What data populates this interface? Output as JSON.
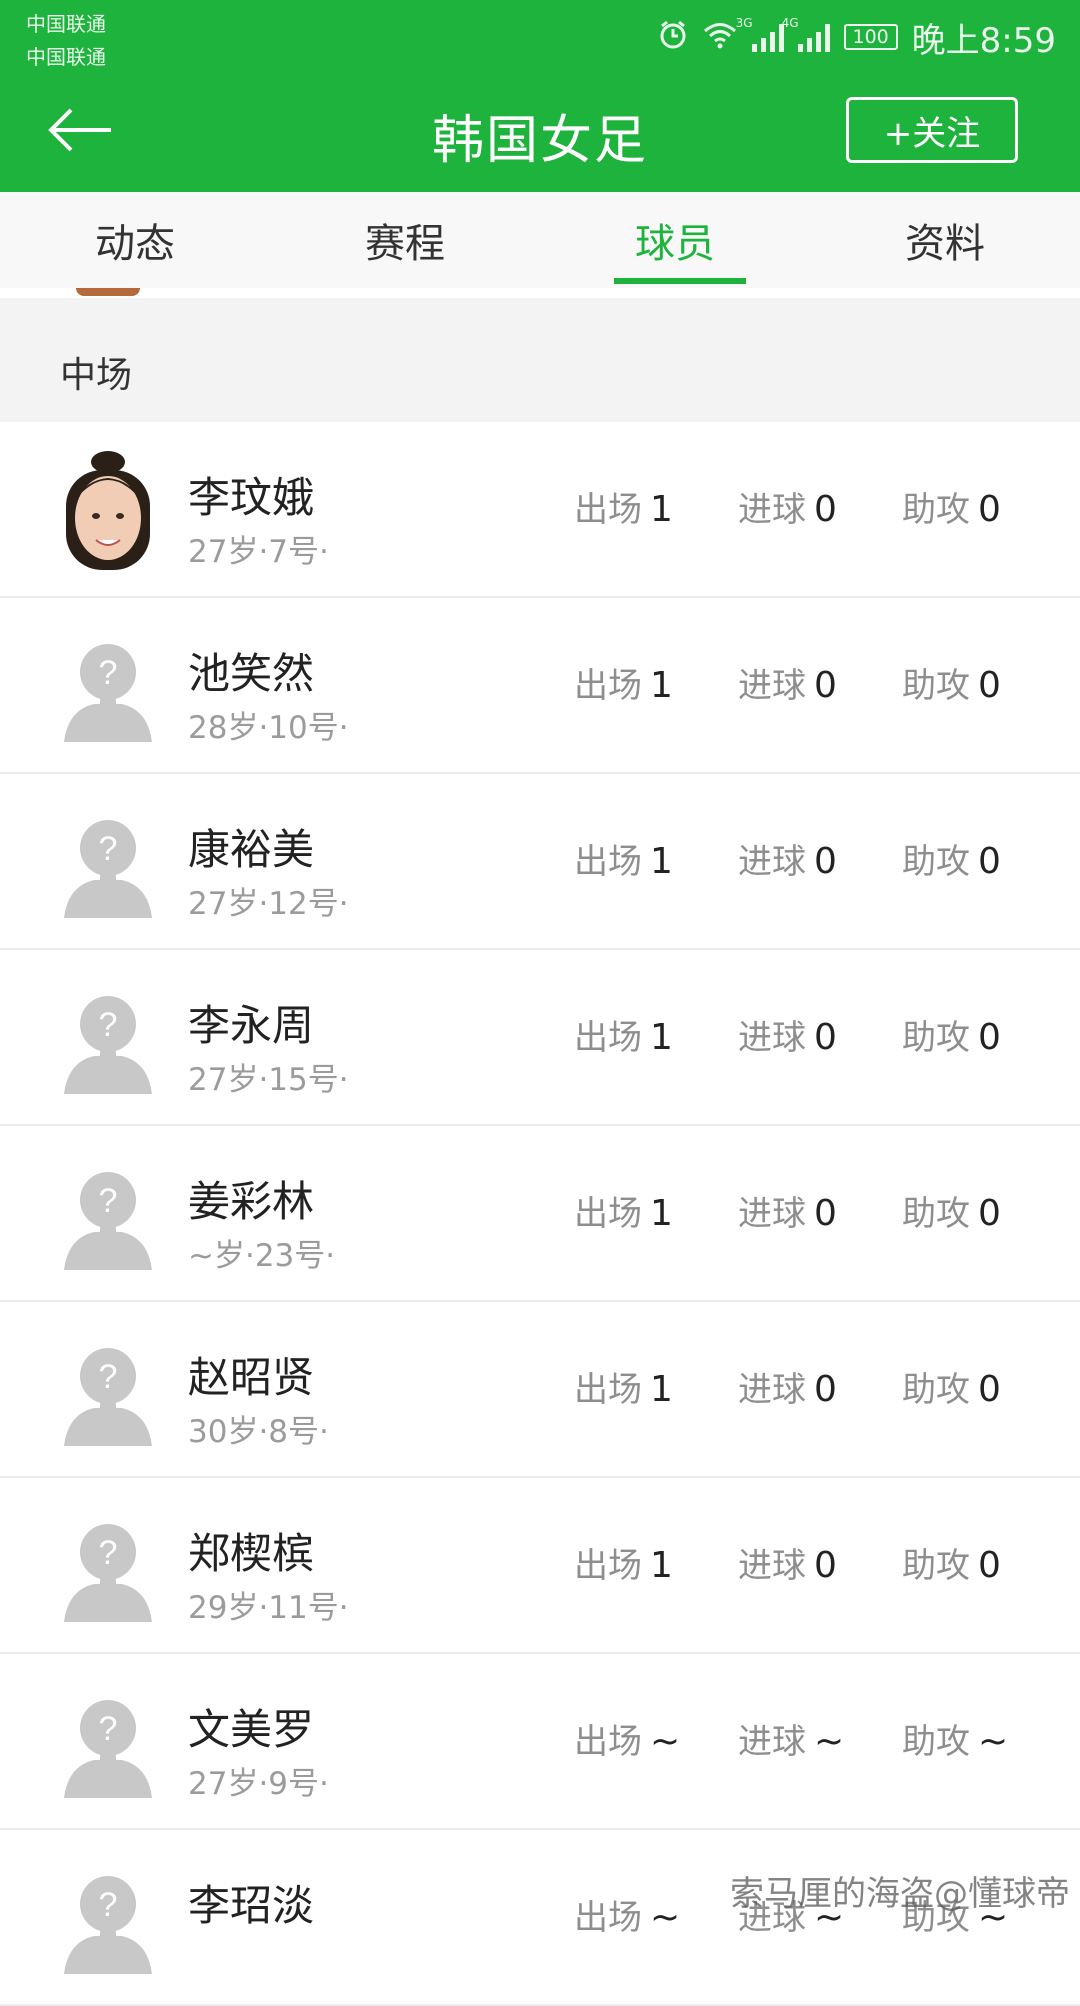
{
  "status_bar": {
    "carrier_1": "中国联通",
    "carrier_2": "中国联通",
    "net_1": "3G",
    "net_2": "4G",
    "battery": "100",
    "time": "晚上8:59"
  },
  "header": {
    "title": "韩国女足",
    "follow_label": "+关注"
  },
  "tabs": [
    {
      "label": "动态"
    },
    {
      "label": "赛程"
    },
    {
      "label": "球员"
    },
    {
      "label": "资料"
    }
  ],
  "active_tab": "球员",
  "section": {
    "title": "中场"
  },
  "stat_labels": {
    "appearances": "出场",
    "goals": "进球",
    "assists": "助攻"
  },
  "players": [
    {
      "name": "李玟娥",
      "meta": "27岁·7号·",
      "apps": "1",
      "goals": "0",
      "assists": "0",
      "has_photo": true
    },
    {
      "name": "池笑然",
      "meta": "28岁·10号·",
      "apps": "1",
      "goals": "0",
      "assists": "0",
      "has_photo": false
    },
    {
      "name": "康裕美",
      "meta": "27岁·12号·",
      "apps": "1",
      "goals": "0",
      "assists": "0",
      "has_photo": false
    },
    {
      "name": "李永周",
      "meta": "27岁·15号·",
      "apps": "1",
      "goals": "0",
      "assists": "0",
      "has_photo": false
    },
    {
      "name": "姜彩林",
      "meta": "~岁·23号·",
      "apps": "1",
      "goals": "0",
      "assists": "0",
      "has_photo": false
    },
    {
      "name": "赵昭贤",
      "meta": "30岁·8号·",
      "apps": "1",
      "goals": "0",
      "assists": "0",
      "has_photo": false
    },
    {
      "name": "郑楔槟",
      "meta": "29岁·11号·",
      "apps": "1",
      "goals": "0",
      "assists": "0",
      "has_photo": false
    },
    {
      "name": "文美罗",
      "meta": "27岁·9号·",
      "apps": "~",
      "goals": "~",
      "assists": "~",
      "has_photo": false
    },
    {
      "name": "李玿淡",
      "meta": "",
      "apps": "~",
      "goals": "~",
      "assists": "~",
      "has_photo": false
    }
  ],
  "watermark": "索马厘的海盗@懂球帝",
  "colors": {
    "brand": "#1db33c",
    "tab_bar": "#f8f8f8",
    "section_bg": "#f3f3f3"
  }
}
